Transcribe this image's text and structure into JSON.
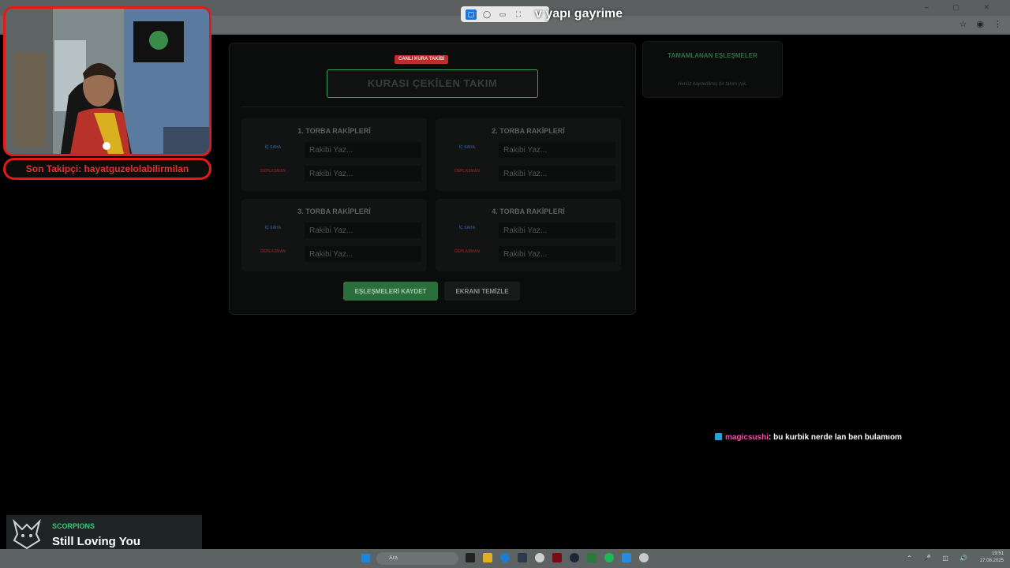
{
  "browser": {
    "window_controls": "– ▢ ✕",
    "toolbar_icons": [
      "☆",
      "◉",
      "⋮"
    ]
  },
  "snip_toolbar": {
    "tools": [
      "rectangle-icon",
      "freeform-icon",
      "window-icon",
      "fullscreen-icon"
    ]
  },
  "subtitle": "v yapı gayrime",
  "main": {
    "badge": "CANLI KURA TAKİBİ",
    "drawn_team_placeholder": "KURASI ÇEKİLEN TAKIM",
    "pots": [
      {
        "title": "1. TORBA RAKİPLERİ",
        "home_tag": "İÇ SAHA",
        "away_tag": "DEPLASMAN",
        "home_placeholder": "Rakibi Yaz...",
        "away_placeholder": "Rakibi Yaz..."
      },
      {
        "title": "2. TORBA RAKİPLERİ",
        "home_tag": "İÇ SAHA",
        "away_tag": "DEPLASMAN",
        "home_placeholder": "Rakibi Yaz...",
        "away_placeholder": "Rakibi Yaz..."
      },
      {
        "title": "3. TORBA RAKİPLERİ",
        "home_tag": "İÇ SAHA",
        "away_tag": "DEPLASMAN",
        "home_placeholder": "Rakibi Yaz...",
        "away_placeholder": "Rakibi Yaz..."
      },
      {
        "title": "4. TORBA RAKİPLERİ",
        "home_tag": "İÇ SAHA",
        "away_tag": "DEPLASMAN",
        "home_placeholder": "Rakibi Yaz...",
        "away_placeholder": "Rakibi Yaz..."
      }
    ],
    "save_button": "EŞLEŞMELERİ KAYDET",
    "clear_button": "EKRANI TEMİZLE"
  },
  "completed": {
    "title": "TAMAMLANAN EŞLEŞMELER",
    "empty_text": "Henüz kaydedilmiş bir takım yok."
  },
  "overlay": {
    "last_follower": "Son Takipçi: hayatguzelolabilirmilan"
  },
  "chat": {
    "username": "magicsushi",
    "message": ": bu kurbik nerde lan ben bulamıom"
  },
  "now_playing": {
    "artist": "SCORPIONS",
    "song": "Still Loving You"
  },
  "taskbar": {
    "search_placeholder": "Ara",
    "time": "19:51",
    "date": "27.08.2025"
  },
  "colors": {
    "accent_green": "#3da35a",
    "live_red": "#c02b2b",
    "overlay_red": "#e21a1a",
    "chat_user": "#e256a6"
  }
}
